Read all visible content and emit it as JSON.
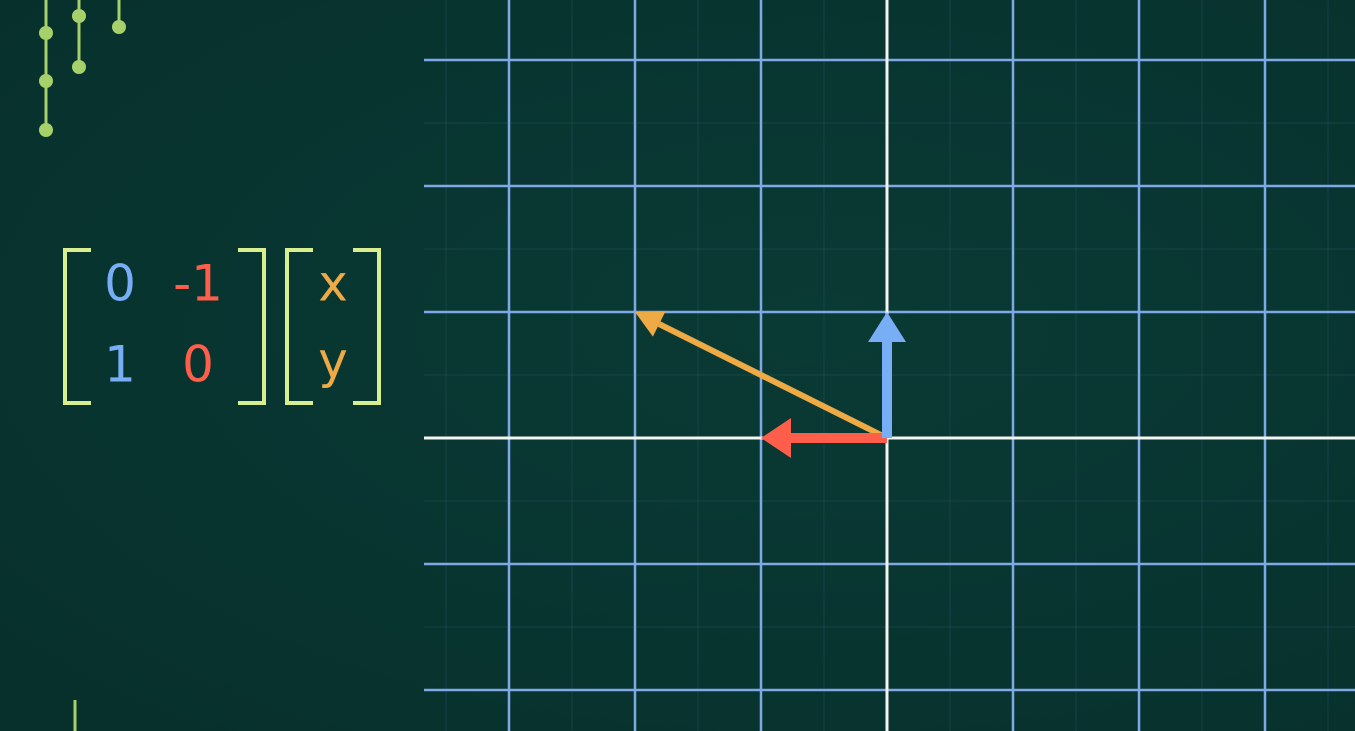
{
  "colors": {
    "background": "#083430",
    "grid": "#7ea8e6",
    "axis": "#f2f5f0",
    "bracket": "#d8ef8f",
    "ihat": "#ff5f4a",
    "jhat": "#78aef5",
    "vector": "#eeaa44",
    "decoration": "#a6d06a"
  },
  "matrix": {
    "entries": [
      [
        "0",
        "-1"
      ],
      [
        "1",
        "0"
      ]
    ],
    "column_colors": [
      "#78aef5",
      "#ff5f4a"
    ]
  },
  "input_vector": {
    "entries": [
      "x",
      "y"
    ],
    "color": "#eeaa44"
  },
  "plane": {
    "x_min": -3.7,
    "x_max": 3.7,
    "y_min": -2.3,
    "y_max": 3.5,
    "grid_step": 1
  },
  "vectors": [
    {
      "name": "i-hat",
      "x": -1,
      "y": 0,
      "color": "#ff5f4a"
    },
    {
      "name": "j-hat",
      "x": 0,
      "y": 1,
      "color": "#78aef5"
    },
    {
      "name": "transformed-vector",
      "x": -2,
      "y": 1,
      "color": "#eeaa44"
    }
  ]
}
